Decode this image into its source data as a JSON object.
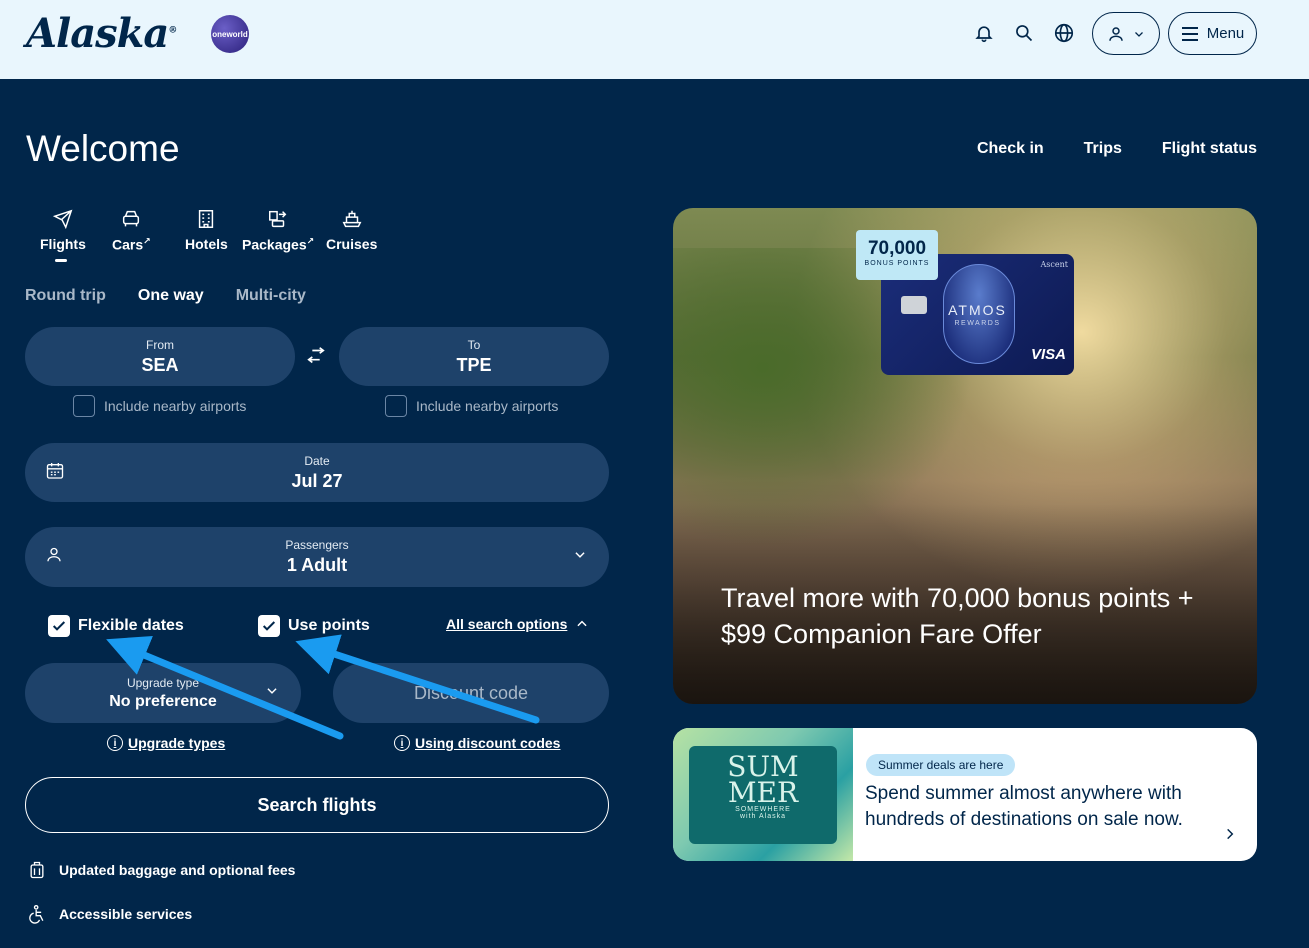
{
  "header": {
    "logo_text": "Alaska",
    "oneworld_text": "oneworld",
    "menu_label": "Menu"
  },
  "welcome": "Welcome",
  "top_links": [
    "Check in",
    "Trips",
    "Flight status"
  ],
  "product_tabs": [
    {
      "label": "Flights",
      "icon": "plane-icon"
    },
    {
      "label": "Cars",
      "icon": "car-icon",
      "external": true
    },
    {
      "label": "Hotels",
      "icon": "hotel-icon"
    },
    {
      "label": "Packages",
      "icon": "packages-icon",
      "external": true
    },
    {
      "label": "Cruises",
      "icon": "ship-icon"
    }
  ],
  "trip_types": {
    "round": "Round trip",
    "oneway": "One way",
    "multi": "Multi-city",
    "selected": "One way"
  },
  "from": {
    "label": "From",
    "value": "SEA"
  },
  "to": {
    "label": "To",
    "value": "TPE"
  },
  "nearby": "Include nearby airports",
  "date": {
    "label": "Date",
    "value": "Jul 27"
  },
  "passengers": {
    "label": "Passengers",
    "value": "1 Adult"
  },
  "flexible_dates": {
    "label": "Flexible dates",
    "checked": true
  },
  "use_points": {
    "label": "Use points",
    "checked": true
  },
  "all_search_options": "All search options",
  "upgrade": {
    "label": "Upgrade type",
    "value": "No preference"
  },
  "discount_code": {
    "placeholder": "Discount code"
  },
  "upgrade_types_link": "Upgrade types",
  "discount_link": "Using discount codes",
  "search_button": "Search flights",
  "bottom_links": [
    {
      "label": "Updated baggage and optional fees",
      "icon": "luggage-icon"
    },
    {
      "label": "Accessible services",
      "icon": "accessibility-icon"
    }
  ],
  "promo": {
    "text": "Travel more with 70,000 bonus points + $99 Companion Fare Offer",
    "badge_number": "70,000",
    "badge_sub": "BONUS POINTS",
    "card_atmos": "ATMOS",
    "card_rewards": "REWARDS",
    "card_ascent": "Ascent",
    "card_visa": "VISA"
  },
  "deal": {
    "tag": "Summer deals are here",
    "text": "Spend summer almost anywhere with hundreds of destinations on sale now.",
    "img_line1": "SUM",
    "img_line2": "MER",
    "img_sub": "SOMEWHERE",
    "img_with": "with Alaska"
  },
  "colors": {
    "navy": "#01264a",
    "field": "#1e426a",
    "header_bg": "#e9f6fd",
    "annotation_arrow": "#1a9bf0"
  }
}
